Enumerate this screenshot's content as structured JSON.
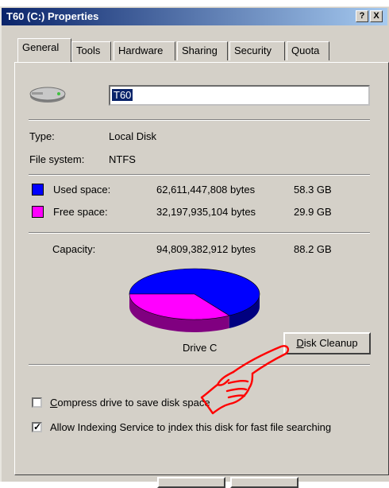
{
  "window": {
    "title": "T60 (C:) Properties",
    "help_button": "?",
    "close_button": "X"
  },
  "tabs": [
    {
      "label": "General",
      "active": true
    },
    {
      "label": "Tools"
    },
    {
      "label": "Hardware"
    },
    {
      "label": "Sharing"
    },
    {
      "label": "Security"
    },
    {
      "label": "Quota"
    }
  ],
  "drive": {
    "name": "T60",
    "type_label": "Type:",
    "type_value": "Local Disk",
    "fs_label": "File system:",
    "fs_value": "NTFS",
    "caption": "Drive C"
  },
  "space": {
    "used_label": "Used space:",
    "used_bytes": "62,611,447,808 bytes",
    "used_gb": "58.3 GB",
    "free_label": "Free space:",
    "free_bytes": "32,197,935,104 bytes",
    "free_gb": "29.9 GB",
    "capacity_label": "Capacity:",
    "capacity_bytes": "94,809,382,912 bytes",
    "capacity_gb": "88.2 GB"
  },
  "buttons": {
    "disk_cleanup_u": "D",
    "disk_cleanup_rest": "isk Cleanup"
  },
  "options": {
    "compress_u": "C",
    "compress_rest": "ompress drive to save disk space",
    "compress_checked": false,
    "index_pre": "Allow Indexing Service to ",
    "index_u": "i",
    "index_rest": "ndex this disk for fast file searching",
    "index_checked": true
  },
  "colors": {
    "titlebar_start": "#0a246a",
    "titlebar_end": "#a6caf0",
    "used": "#0000ff",
    "free": "#ff00ff",
    "pointer_hand": "#ff0000"
  },
  "chart_data": {
    "type": "pie",
    "labels": [
      "Used space",
      "Free space"
    ],
    "values": [
      62611447808,
      32197935104
    ]
  }
}
